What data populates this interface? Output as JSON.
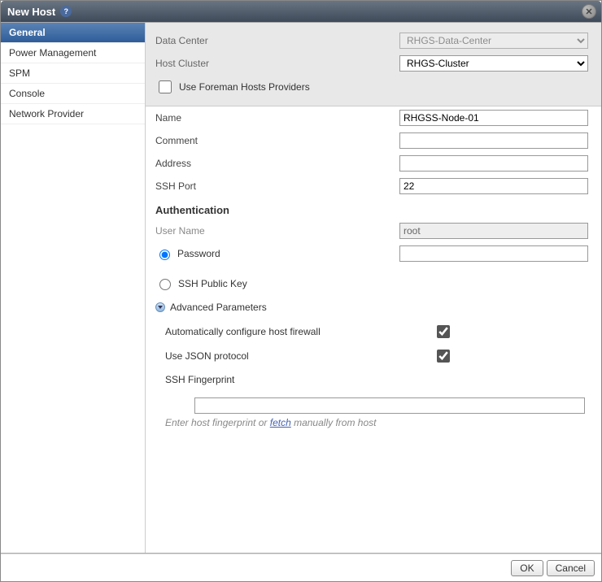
{
  "title": "New Host",
  "sidebar": {
    "items": [
      {
        "label": "General",
        "selected": true
      },
      {
        "label": "Power Management",
        "selected": false
      },
      {
        "label": "SPM",
        "selected": false
      },
      {
        "label": "Console",
        "selected": false
      },
      {
        "label": "Network Provider",
        "selected": false
      }
    ]
  },
  "form": {
    "data_center_label": "Data Center",
    "data_center_value": "RHGS-Data-Center",
    "host_cluster_label": "Host Cluster",
    "host_cluster_value": "RHGS-Cluster",
    "foreman_label": "Use Foreman Hosts Providers",
    "name_label": "Name",
    "name_value": "RHGSS-Node-01",
    "comment_label": "Comment",
    "comment_value": "",
    "address_label": "Address",
    "address_value": "",
    "ssh_port_label": "SSH Port",
    "ssh_port_value": "22"
  },
  "auth": {
    "heading": "Authentication",
    "username_label": "User Name",
    "username_value": "root",
    "password_label": "Password",
    "password_value": "",
    "ssh_key_label": "SSH Public Key"
  },
  "advanced": {
    "heading": "Advanced Parameters",
    "firewall_label": "Automatically configure host firewall",
    "json_label": "Use JSON protocol",
    "ssh_fp_label": "SSH Fingerprint",
    "ssh_fp_value": "",
    "hint_prefix": "Enter host fingerprint or ",
    "hint_link": "fetch",
    "hint_suffix": " manually from host"
  },
  "buttons": {
    "ok": "OK",
    "cancel": "Cancel"
  }
}
